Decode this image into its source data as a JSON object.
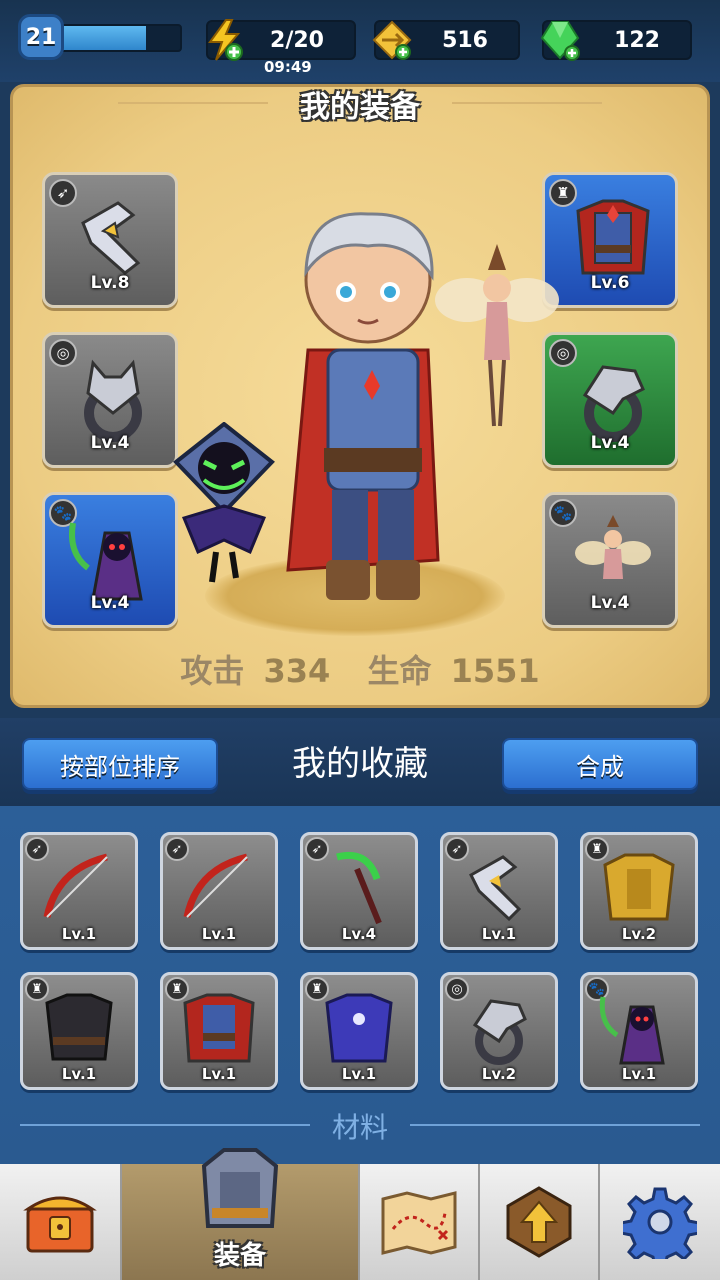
{
  "top_bar": {
    "level": "21",
    "level_progress": 0.75,
    "energy": "2/20",
    "energy_timer": "09:49",
    "gold": "516",
    "gems": "122"
  },
  "equipment": {
    "title": "我的装备",
    "slots": [
      {
        "level": "Lv.8",
        "type_icon": "bow-icon",
        "item_icon": "boomerang-icon",
        "rarity": "gray"
      },
      {
        "level": "Lv.6",
        "type_icon": "armor-icon",
        "item_icon": "caped-vest-icon",
        "rarity": "blue"
      },
      {
        "level": "Lv.4",
        "type_icon": "ring-icon",
        "item_icon": "wolf-ring-icon",
        "rarity": "gray"
      },
      {
        "level": "Lv.4",
        "type_icon": "ring-icon",
        "item_icon": "eagle-ring-icon",
        "rarity": "green"
      },
      {
        "level": "Lv.4",
        "type_icon": "pet-paw-icon",
        "item_icon": "reaper-pet-icon",
        "rarity": "blue"
      },
      {
        "level": "Lv.4",
        "type_icon": "pet-paw-icon",
        "item_icon": "fairy-pet-icon",
        "rarity": "gray"
      }
    ],
    "stats": {
      "attack_label": "攻击",
      "attack_value": "334",
      "hp_label": "生命",
      "hp_value": "1551"
    }
  },
  "collection": {
    "sort_button": "按部位排序",
    "title": "我的收藏",
    "merge_button": "合成",
    "items": [
      {
        "level": "Lv.1",
        "type_icon": "bow-icon",
        "item_icon": "red-bow-icon"
      },
      {
        "level": "Lv.1",
        "type_icon": "bow-icon",
        "item_icon": "red-bow-icon"
      },
      {
        "level": "Lv.4",
        "type_icon": "bow-icon",
        "item_icon": "scythe-icon"
      },
      {
        "level": "Lv.1",
        "type_icon": "bow-icon",
        "item_icon": "boomerang-icon"
      },
      {
        "level": "Lv.2",
        "type_icon": "armor-icon",
        "item_icon": "gold-armor-icon"
      },
      {
        "level": "Lv.1",
        "type_icon": "armor-icon",
        "item_icon": "black-vest-icon"
      },
      {
        "level": "Lv.1",
        "type_icon": "armor-icon",
        "item_icon": "caped-vest-icon"
      },
      {
        "level": "Lv.1",
        "type_icon": "armor-icon",
        "item_icon": "mage-robe-icon"
      },
      {
        "level": "Lv.2",
        "type_icon": "ring-icon",
        "item_icon": "eagle-ring-icon"
      },
      {
        "level": "Lv.1",
        "type_icon": "pet-paw-icon",
        "item_icon": "reaper-pet-icon"
      }
    ],
    "materials_label": "材料"
  },
  "nav": {
    "items": [
      {
        "icon": "treasure-chest-icon",
        "label": ""
      },
      {
        "icon": "armor-helmet-icon",
        "label": "装备"
      },
      {
        "icon": "map-icon",
        "label": ""
      },
      {
        "icon": "upgrade-arrow-icon",
        "label": ""
      },
      {
        "icon": "gear-icon",
        "label": ""
      }
    ]
  },
  "colors": {
    "background": "#1d3a5c",
    "panel": "#eccc83",
    "blue_button": "#3b86e0",
    "rarity_blue": "#2d66cc",
    "rarity_green": "#2f8a3e",
    "rarity_gray": "#707070"
  }
}
